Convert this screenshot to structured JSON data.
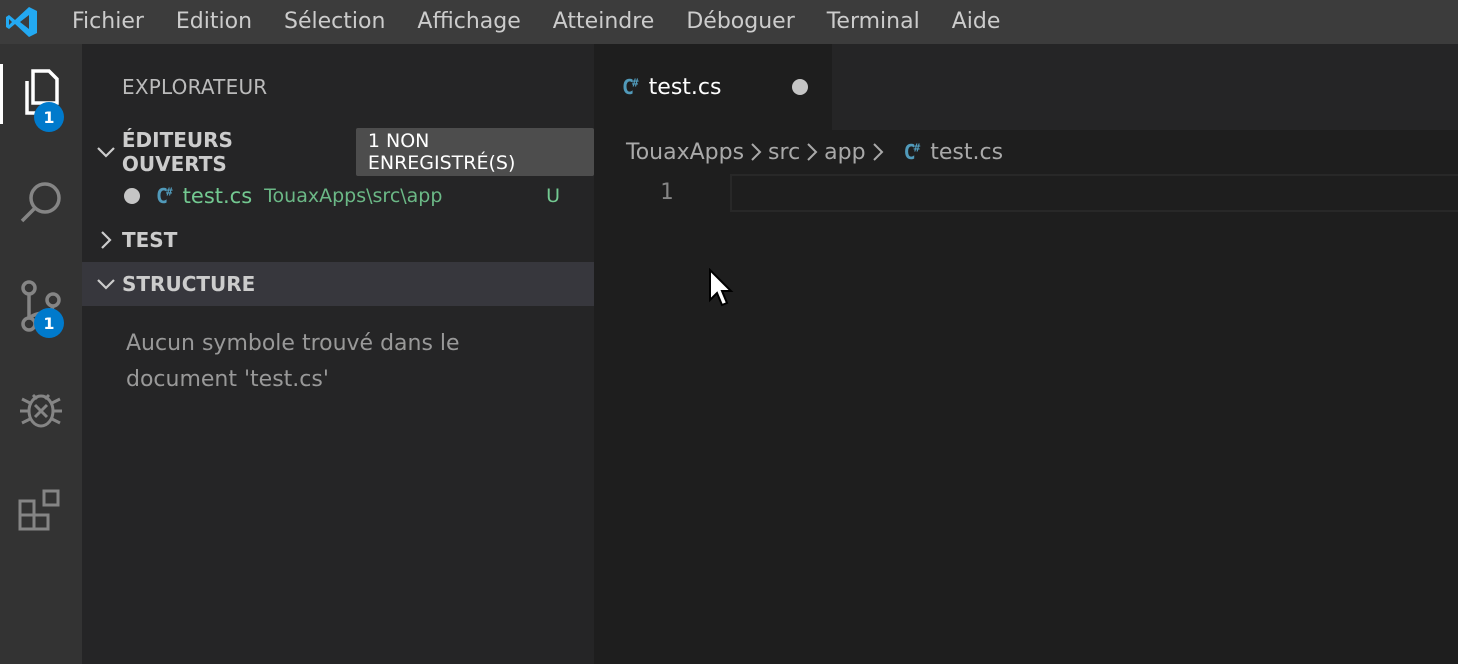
{
  "menu": [
    "Fichier",
    "Edition",
    "Sélection",
    "Affichage",
    "Atteindre",
    "Déboguer",
    "Terminal",
    "Aide"
  ],
  "activity": {
    "explorer_badge": "1",
    "scm_badge": "1"
  },
  "sidebar": {
    "title": "EXPLORATEUR",
    "open_editors": {
      "label": "ÉDITEURS OUVERTS",
      "pill": "1 NON ENREGISTRÉ(S)",
      "file": {
        "name": "test.cs",
        "path": "TouaxApps\\src\\app",
        "status": "U"
      }
    },
    "test_section": "TEST",
    "structure_section": "STRUCTURE",
    "structure_empty": "Aucun symbole trouvé dans le document 'test.cs'"
  },
  "editor": {
    "tab": {
      "label": "test.cs"
    },
    "breadcrumbs": [
      "TouaxApps",
      "src",
      "app",
      "test.cs"
    ],
    "line_number": "1"
  },
  "colors": {
    "accent": "#007acc",
    "csharp_icon": "#519aba",
    "untracked": "#73c991"
  }
}
